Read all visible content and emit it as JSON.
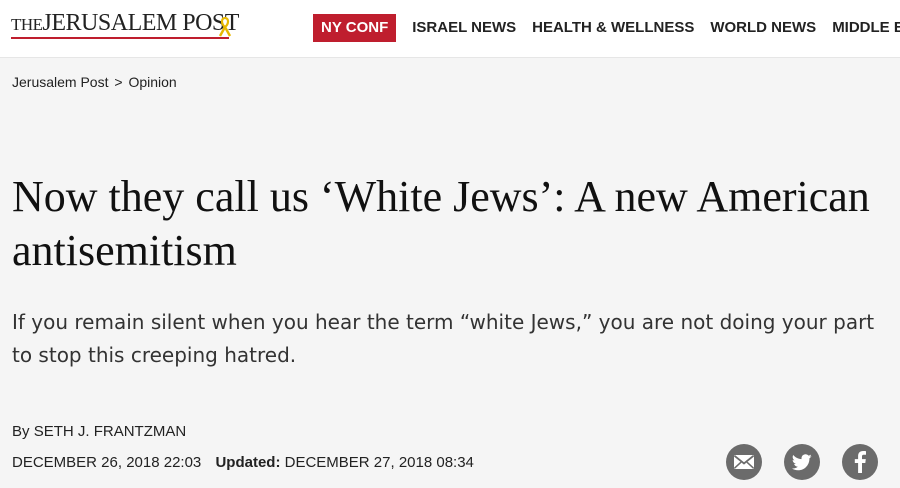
{
  "header": {
    "logo_the": "THE",
    "logo_name": "JERUSALEM POST",
    "nav": [
      {
        "label": "NY CONF",
        "highlight": true
      },
      {
        "label": "ISRAEL NEWS"
      },
      {
        "label": "HEALTH & WELLNESS"
      },
      {
        "label": "WORLD NEWS"
      },
      {
        "label": "MIDDLE EAST"
      }
    ]
  },
  "breadcrumb": {
    "home": "Jerusalem Post",
    "separator": ">",
    "section": "Opinion"
  },
  "article": {
    "headline": "Now they call us ‘White Jews’: A new American antisemitism",
    "subhead": "If you remain silent when you hear the term “white Jews,” you are not doing your part to stop this creeping hatred.",
    "byline_prefix": "By",
    "author": "SETH J. FRANTZMAN",
    "published": "DECEMBER 26, 2018 22:03",
    "updated_label": "Updated:",
    "updated": "DECEMBER 27, 2018 08:34"
  },
  "share": {
    "icons": [
      "email-icon",
      "twitter-icon",
      "facebook-icon"
    ],
    "icon_color": "#6b6b6b"
  },
  "colors": {
    "brand_red": "#bf1e2e",
    "background": "#f5f5f5"
  }
}
